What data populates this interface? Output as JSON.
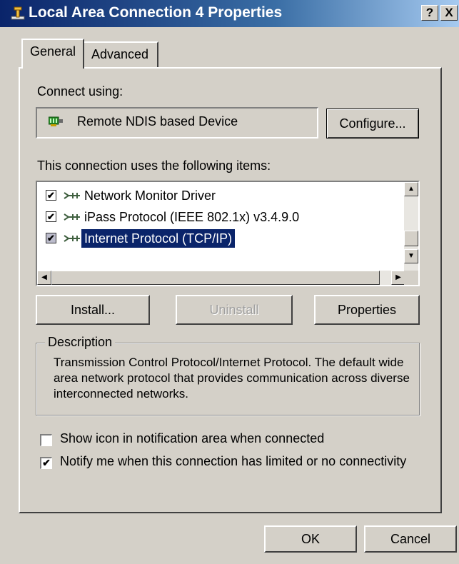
{
  "window": {
    "title": "Local Area Connection 4 Properties",
    "help_label": "?",
    "close_label": "X"
  },
  "tabs": [
    {
      "label": "General",
      "active": true
    },
    {
      "label": "Advanced",
      "active": false
    }
  ],
  "connect_using": {
    "label": "Connect using:",
    "device_name": "Remote NDIS based Device",
    "configure_label": "Configure..."
  },
  "items_section": {
    "label": "This connection uses the following items:",
    "items": [
      {
        "label": "Network Monitor Driver",
        "checked": true,
        "selected": false
      },
      {
        "label": "iPass Protocol (IEEE 802.1x) v3.4.9.0",
        "checked": true,
        "selected": false
      },
      {
        "label": "Internet Protocol (TCP/IP)",
        "checked": true,
        "selected": true
      }
    ]
  },
  "buttons": {
    "install": "Install...",
    "uninstall": "Uninstall",
    "properties": "Properties"
  },
  "description": {
    "legend": "Description",
    "text": "Transmission Control Protocol/Internet Protocol. The default wide area network protocol that provides communication across diverse interconnected networks."
  },
  "options": [
    {
      "label": "Show icon in notification area when connected",
      "checked": false
    },
    {
      "label": "Notify me when this connection has limited or no connectivity",
      "checked": true
    }
  ],
  "footer": {
    "ok_label": "OK",
    "cancel_label": "Cancel"
  },
  "colors": {
    "selection": "#0a246a",
    "face": "#d4d0c8"
  }
}
